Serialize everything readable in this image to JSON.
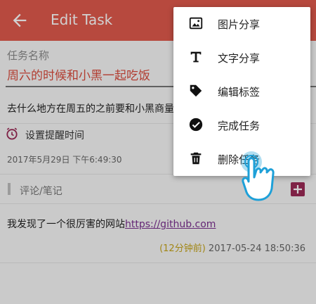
{
  "appbar": {
    "title": "Edit Task",
    "back_icon": "arrow-left-icon"
  },
  "task": {
    "name_label": "任务名称",
    "name_value": "周六的时候和小黑一起吃饭",
    "detail": "去什么地方在周五的之前要和小黑商量"
  },
  "reminder": {
    "label": "设置提醒时间",
    "time": "2017年5月29日 下午6:49:30",
    "icon": "alarm-icon"
  },
  "comments": {
    "title": "评论/笔记",
    "add_icon": "plus-icon",
    "items": [
      {
        "text": "我发现了一个很厉害的网站",
        "link": "https://github.com",
        "ago": "(12分钟前)",
        "timestamp": "2017-05-24 18:50:36"
      }
    ]
  },
  "menu": {
    "items": [
      {
        "label": "图片分享",
        "icon": "image-icon"
      },
      {
        "label": "文字分享",
        "icon": "text-icon"
      },
      {
        "label": "编辑标签",
        "icon": "tag-icon"
      },
      {
        "label": "完成任务",
        "icon": "check-circle-icon"
      },
      {
        "label": "删除任务",
        "icon": "trash-icon"
      }
    ]
  },
  "colors": {
    "appbar": "#e05a4c",
    "task_name": "#d94b3c",
    "link": "#7a2f8f",
    "ago": "#c5a41a",
    "add_button": "#9c2a56",
    "hand_cursor": "#1ea0d8"
  }
}
